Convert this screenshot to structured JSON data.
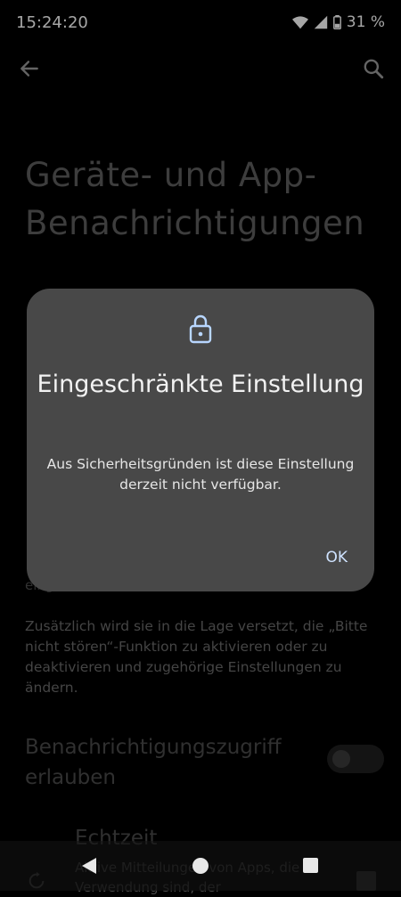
{
  "status_bar": {
    "time": "15:24:20",
    "battery": "31 %",
    "icons": [
      "wifi-icon",
      "signal-icon",
      "battery-icon"
    ]
  },
  "app_bar": {
    "back_icon": "arrow-left-icon",
    "search_icon": "search-icon"
  },
  "page": {
    "title": "Geräte- und App-Benachrichtigungen",
    "partial_line": "eing",
    "description": "Zusätzlich wird sie in die Lage versetzt, die „Bitte nicht stören“-Funktion zu aktivieren oder zu deaktivieren und zugehörige Einstellungen zu ändern.",
    "access_label": "Benachrichtigungszugriff erlauben",
    "access_enabled": false,
    "item_title": "Echtzeit",
    "item_description": "Aktive Mitteilungen von Apps, die in Verwendung sind, der"
  },
  "dialog": {
    "icon": "lock-icon",
    "title": "Eingeschränkte Einstellung",
    "message": "Aus Sicherheitsgründen ist diese Einstellung derzeit nicht verfügbar.",
    "ok_label": "OK"
  },
  "nav_bar": {
    "icons": [
      "nav-back-icon",
      "nav-home-icon",
      "nav-recents-icon"
    ]
  },
  "colors": {
    "background": "#000000",
    "dialog": "#484848",
    "accent": "#cfe3ff"
  }
}
